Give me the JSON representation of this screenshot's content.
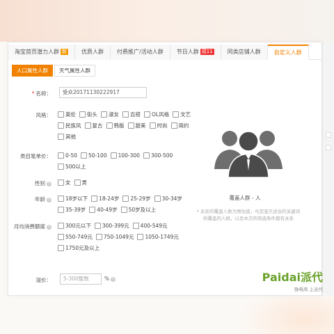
{
  "tabs": [
    {
      "label": "淘宝首页潜力人群",
      "badge": "新",
      "badge_kind": "new",
      "active": false
    },
    {
      "label": "优质人群",
      "badge": "",
      "active": false
    },
    {
      "label": "付费推广/活动人群",
      "badge": "",
      "active": false
    },
    {
      "label": "节日人群",
      "badge": "双11",
      "badge_kind": "hot",
      "active": false
    },
    {
      "label": "同类店铺人群",
      "badge": "",
      "active": false
    },
    {
      "label": "自定义人群",
      "badge": "",
      "active": true
    }
  ],
  "subtabs": [
    {
      "label": "人口属性人群",
      "active": true
    },
    {
      "label": "天气属性人群",
      "active": false
    }
  ],
  "form": {
    "name_label": "名称：",
    "name_required": "*",
    "name_value": "受众20171130222917",
    "style_label": "风格：",
    "style_options": [
      "英伦",
      "街头",
      "淑女",
      "百搭",
      "OL风格",
      "文艺",
      "民族风",
      "复古",
      "韩版",
      "甜美",
      "时尚",
      "简约",
      "其他"
    ],
    "price_label": "类目笔单价：",
    "price_options": [
      "0-50",
      "50-100",
      "100-300",
      "300-500",
      "500以上"
    ],
    "gender_label": "性别",
    "gender_options": [
      "女",
      "男"
    ],
    "age_label": "年龄",
    "age_options": [
      "18岁以下",
      "18-24岁",
      "25-29岁",
      "30-34岁",
      "35-39岁",
      "40-49岁",
      "50岁及以上"
    ],
    "spend_label": "月均消费额度",
    "spend_options": [
      "300元以下",
      "300-399元",
      "400-549元",
      "550-749元",
      "750-1049元",
      "1050-1749元",
      "1750元及以上"
    ],
    "bid_label": "溢价：",
    "bid_placeholder": "5-300整数",
    "bid_unit": "%"
  },
  "panel": {
    "cover_text": "覆盖人群 - 人",
    "note_text": "* 此处的覆盖人数为预估值，与您宝贝适合的关键词所覆盖的人群，以及本次的筛选条件都有关系"
  },
  "logo": {
    "brand_latin": "Paidai",
    "brand_cn": "派代",
    "tagline": "微电商 上派代"
  },
  "colors": {
    "accent": "#f18100",
    "logo_green": "#8cbf3f"
  }
}
